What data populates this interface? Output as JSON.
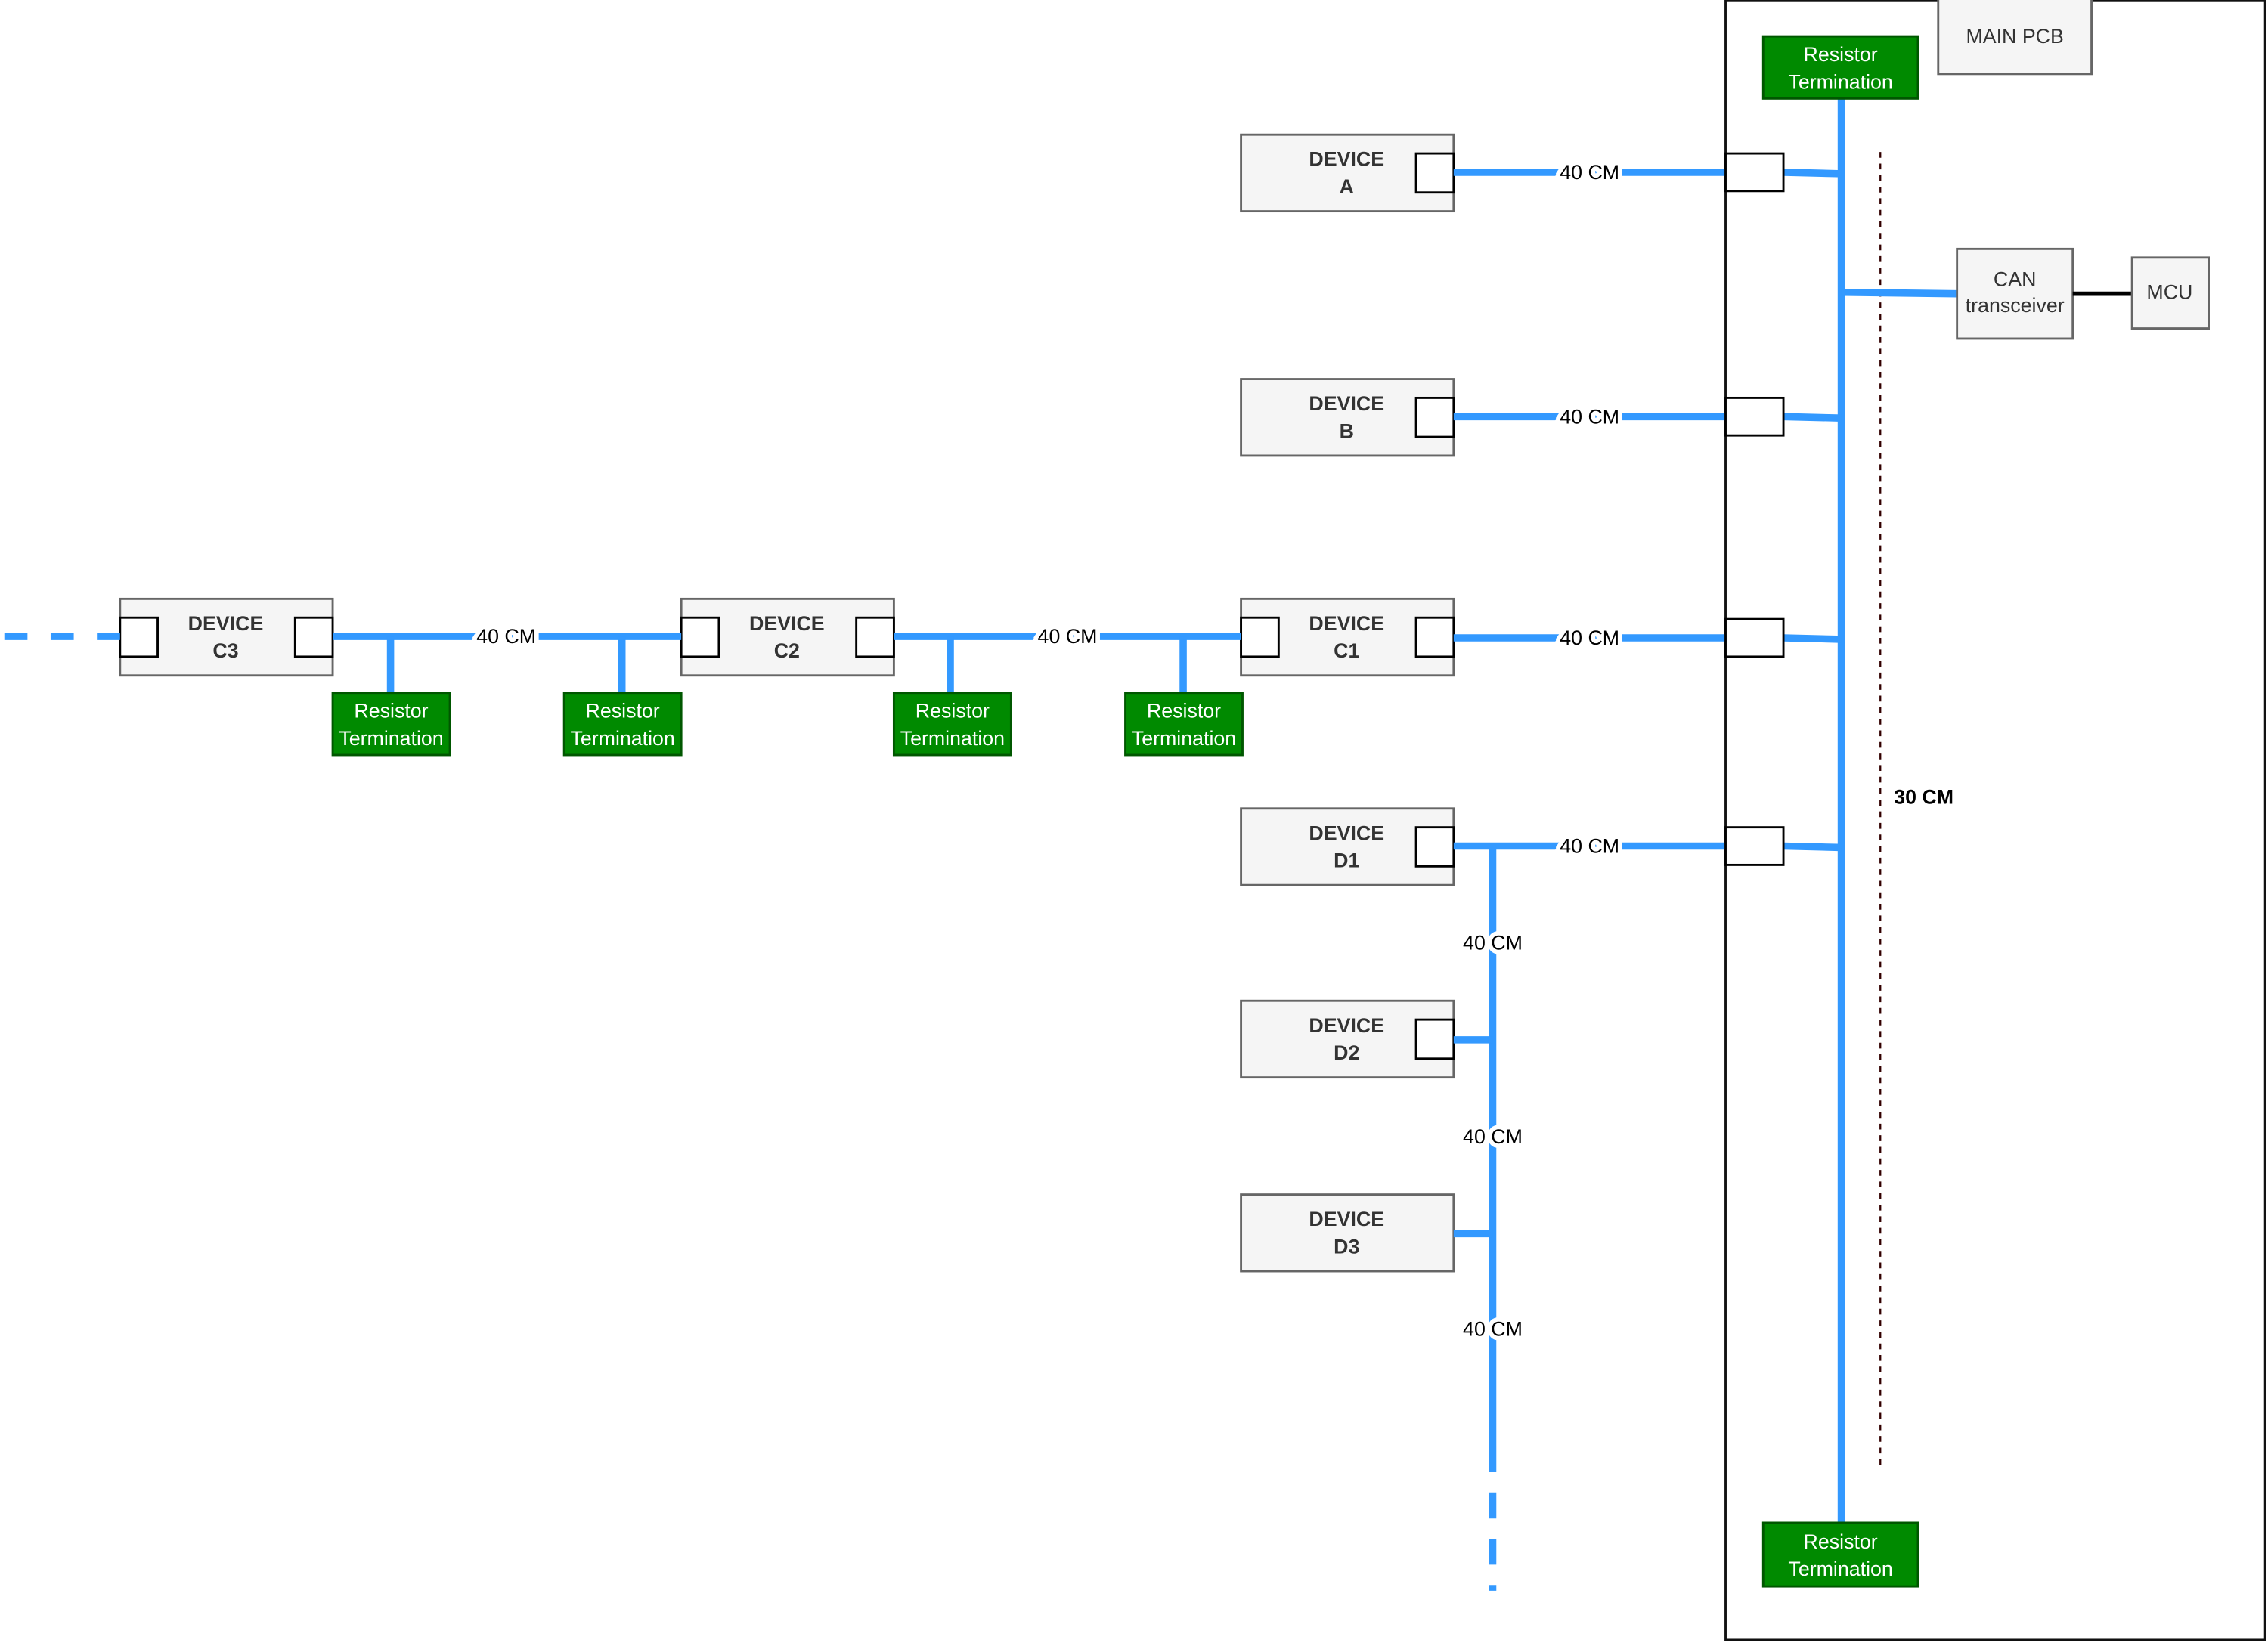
{
  "colors": {
    "bus": "#3399ff",
    "resistor_fill": "#008a00",
    "resistor_stroke": "#005700",
    "box_fill": "#f5f5f5",
    "box_stroke": "#666666"
  },
  "main_pcb": {
    "label": "MAIN PCB",
    "length_label": "30 CM"
  },
  "can_transceiver": {
    "line1": "CAN",
    "line2": "transceiver"
  },
  "mcu": {
    "label": "MCU"
  },
  "resistor": {
    "line1": "Resistor",
    "line2": "Termination"
  },
  "cable_label": "40 CM",
  "devices": [
    {
      "id": "A",
      "line1": "DEVICE",
      "line2": "A"
    },
    {
      "id": "B",
      "line1": "DEVICE",
      "line2": "B"
    },
    {
      "id": "C1",
      "line1": "DEVICE",
      "line2": "C1"
    },
    {
      "id": "C2",
      "line1": "DEVICE",
      "line2": "C2"
    },
    {
      "id": "C3",
      "line1": "DEVICE",
      "line2": "C3"
    },
    {
      "id": "D1",
      "line1": "DEVICE",
      "line2": "D1"
    },
    {
      "id": "D2",
      "line1": "DEVICE",
      "line2": "D2"
    },
    {
      "id": "D3",
      "line1": "DEVICE",
      "line2": "D3"
    }
  ]
}
